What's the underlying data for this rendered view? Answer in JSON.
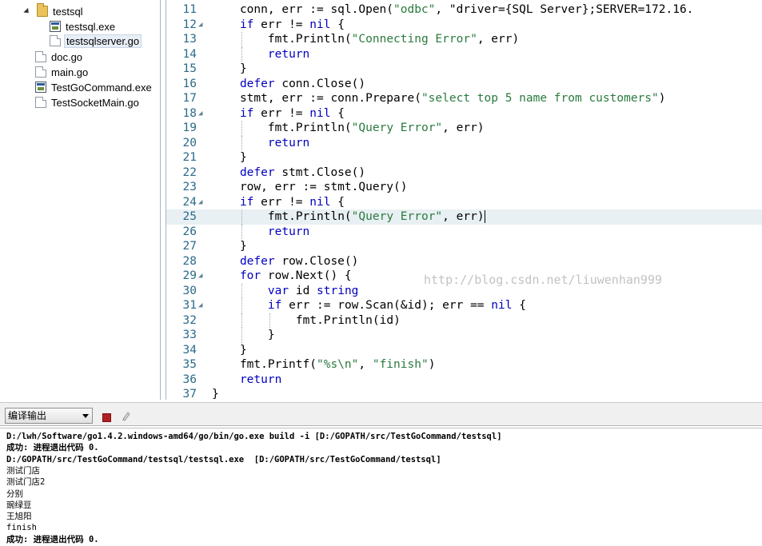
{
  "file_tree": {
    "items": [
      {
        "label": "testsql",
        "icon": "folder-icon"
      },
      {
        "label": "testsql.exe",
        "icon": "exe-file-icon"
      },
      {
        "label": "testsqlserver.go",
        "icon": "go-file-icon"
      },
      {
        "label": "doc.go",
        "icon": "go-file-icon"
      },
      {
        "label": "main.go",
        "icon": "go-file-icon"
      },
      {
        "label": "TestGoCommand.exe",
        "icon": "exe-file-icon"
      },
      {
        "label": "TestSocketMain.go",
        "icon": "go-file-icon"
      }
    ]
  },
  "editor": {
    "lines": [
      {
        "num": "11",
        "code": "conn, err := sql.Open(\"odbc\", \"driver={SQL Server};SERVER=172.16."
      },
      {
        "num": "12",
        "code": "if err != nil {"
      },
      {
        "num": "13",
        "code": "fmt.Println(\"Connecting Error\", err)"
      },
      {
        "num": "14",
        "code": "return"
      },
      {
        "num": "15",
        "code": "}"
      },
      {
        "num": "16",
        "code": "defer conn.Close()"
      },
      {
        "num": "17",
        "code": "stmt, err := conn.Prepare(\"select top 5 name from customers\")"
      },
      {
        "num": "18",
        "code": "if err != nil {"
      },
      {
        "num": "19",
        "code": "fmt.Println(\"Query Error\", err)"
      },
      {
        "num": "20",
        "code": "return"
      },
      {
        "num": "21",
        "code": "}"
      },
      {
        "num": "22",
        "code": "defer stmt.Close()"
      },
      {
        "num": "23",
        "code": "row, err := stmt.Query()"
      },
      {
        "num": "24",
        "code": "if err != nil {"
      },
      {
        "num": "25",
        "code": "fmt.Println(\"Query Error\", err)"
      },
      {
        "num": "26",
        "code": "return"
      },
      {
        "num": "27",
        "code": "}"
      },
      {
        "num": "28",
        "code": "defer row.Close()"
      },
      {
        "num": "29",
        "code": "for row.Next() {"
      },
      {
        "num": "30",
        "code": "var id string"
      },
      {
        "num": "31",
        "code": "if err := row.Scan(&id); err == nil {"
      },
      {
        "num": "32",
        "code": "fmt.Println(id)"
      },
      {
        "num": "33",
        "code": "}"
      },
      {
        "num": "34",
        "code": "}"
      },
      {
        "num": "35",
        "code": "fmt.Printf(\"%s\\n\", \"finish\")"
      },
      {
        "num": "36",
        "code": "return"
      },
      {
        "num": "37",
        "code": "}"
      }
    ],
    "watermark": "http://blog.csdn.net/liuwenhan999"
  },
  "output_panel": {
    "selector_value": "编译输出",
    "lines": [
      "D:/lwh/Software/go1.4.2.windows-amd64/go/bin/go.exe build -i [D:/GOPATH/src/TestGoCommand/testsql]",
      "成功: 进程退出代码 0.",
      "D:/GOPATH/src/TestGoCommand/testsql/testsql.exe  [D:/GOPATH/src/TestGoCommand/testsql]",
      "测试门店",
      "测试门店2",
      "分别",
      "豌绿豆",
      "王旭阳",
      "finish",
      "成功: 进程退出代码 0."
    ]
  },
  "colors": {
    "keyword": "#0000c0",
    "string": "#2a7a3e",
    "line_number": "#2b6b8a",
    "current_line": "#e8f0f3"
  }
}
